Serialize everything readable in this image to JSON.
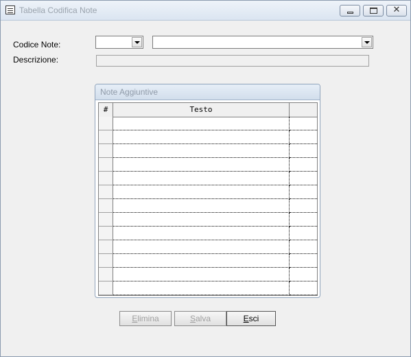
{
  "window": {
    "title": "Tabella Codifica Note"
  },
  "form": {
    "codice_label": "Codice Note:",
    "descrizione_label": "Descrizione:",
    "codice_value": "",
    "codice_desc_value": "",
    "descrizione_value": ""
  },
  "notes_panel": {
    "title": "Note Aggiuntive",
    "columns": [
      "#",
      "Testo",
      ""
    ],
    "rows": [
      [
        "",
        "",
        ""
      ],
      [
        "",
        "",
        ""
      ],
      [
        "",
        "",
        ""
      ],
      [
        "",
        "",
        ""
      ],
      [
        "",
        "",
        ""
      ],
      [
        "",
        "",
        ""
      ],
      [
        "",
        "",
        ""
      ],
      [
        "",
        "",
        ""
      ],
      [
        "",
        "",
        ""
      ],
      [
        "",
        "",
        ""
      ],
      [
        "",
        "",
        ""
      ],
      [
        "",
        "",
        ""
      ],
      [
        "",
        "",
        ""
      ]
    ]
  },
  "buttons": {
    "elimina": {
      "accel": "E",
      "rest": "limina",
      "enabled": false
    },
    "salva": {
      "accel": "S",
      "rest": "alva",
      "enabled": false
    },
    "esci": {
      "accel": "E",
      "rest": "sci",
      "enabled": true
    }
  }
}
